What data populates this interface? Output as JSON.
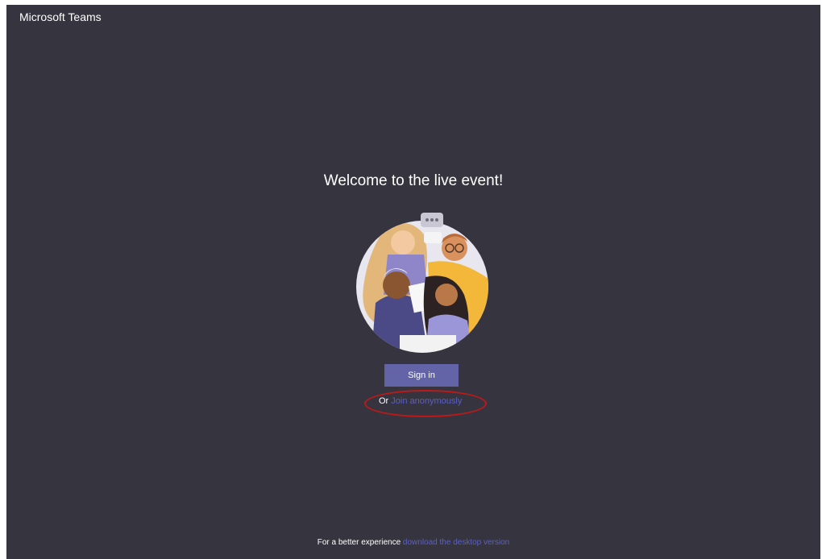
{
  "app": {
    "title": "Microsoft Teams"
  },
  "main": {
    "welcome_heading": "Welcome to the live event!",
    "sign_in_label": "Sign in",
    "or_prefix": "Or",
    "join_link_label": "Join anonymously"
  },
  "footer": {
    "prefix": "For a better experience",
    "link_label": "download the desktop version"
  },
  "colors": {
    "background": "#36353f",
    "accent": "#6264a7",
    "link": "#5b5fc7",
    "annotation": "#c01818"
  },
  "icons": {
    "illustration": "people-illustration"
  }
}
